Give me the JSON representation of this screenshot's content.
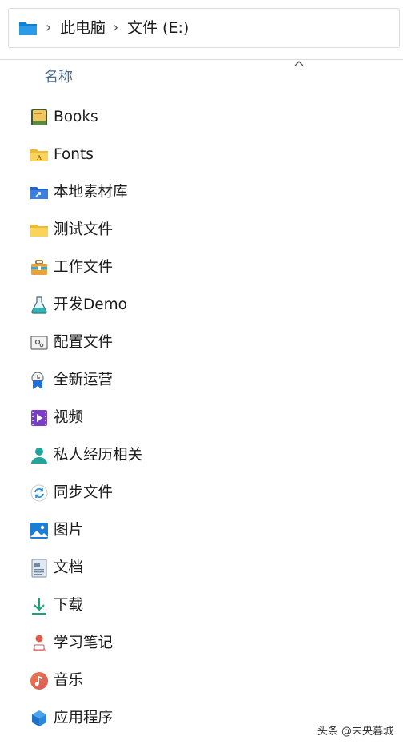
{
  "address_bar": {
    "folder_icon": "folder-icon",
    "separator": "›",
    "crumbs": [
      "此电脑",
      "文件 (E:)"
    ]
  },
  "column_header": {
    "name_label": "名称",
    "sort": "ascending"
  },
  "items": [
    {
      "label": "Books",
      "icon": "books-folder-icon"
    },
    {
      "label": "Fonts",
      "icon": "fonts-folder-icon"
    },
    {
      "label": "本地素材库",
      "icon": "local-materials-folder-icon"
    },
    {
      "label": "测试文件",
      "icon": "folder-icon"
    },
    {
      "label": "工作文件",
      "icon": "work-briefcase-folder-icon"
    },
    {
      "label": "开发Demo",
      "icon": "flask-folder-icon"
    },
    {
      "label": "配置文件",
      "icon": "settings-folder-icon"
    },
    {
      "label": "全新运营",
      "icon": "operations-folder-icon"
    },
    {
      "label": "视频",
      "icon": "videos-folder-icon"
    },
    {
      "label": "私人经历相关",
      "icon": "user-folder-icon"
    },
    {
      "label": "同步文件",
      "icon": "sync-folder-icon"
    },
    {
      "label": "图片",
      "icon": "pictures-folder-icon"
    },
    {
      "label": "文档",
      "icon": "documents-folder-icon"
    },
    {
      "label": "下载",
      "icon": "downloads-folder-icon"
    },
    {
      "label": "学习笔记",
      "icon": "notes-folder-icon"
    },
    {
      "label": "音乐",
      "icon": "music-folder-icon"
    },
    {
      "label": "应用程序",
      "icon": "applications-folder-icon"
    }
  ],
  "watermark": "头条 @未央暮城"
}
